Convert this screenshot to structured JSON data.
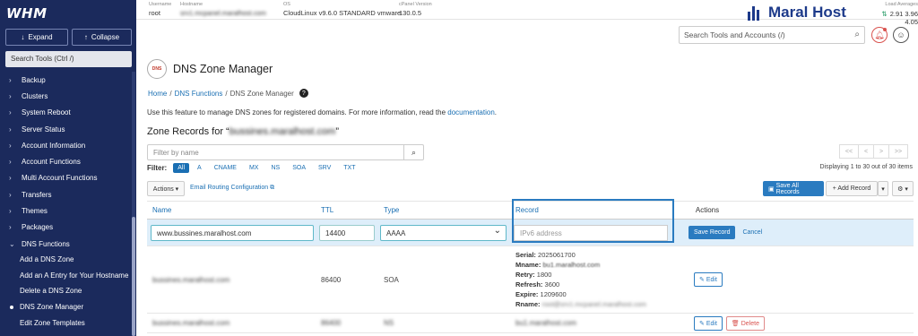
{
  "sidebar": {
    "logo": "WHM",
    "expand_label": "Expand",
    "collapse_label": "Collapse",
    "search_placeholder": "Search Tools (Ctrl /)",
    "items": [
      {
        "label": "Backup"
      },
      {
        "label": "Clusters"
      },
      {
        "label": "System Reboot"
      },
      {
        "label": "Server Status"
      },
      {
        "label": "Account Information"
      },
      {
        "label": "Account Functions"
      },
      {
        "label": "Multi Account Functions"
      },
      {
        "label": "Transfers"
      },
      {
        "label": "Themes"
      },
      {
        "label": "Packages"
      },
      {
        "label": "DNS Functions"
      }
    ],
    "sub_items": [
      {
        "label": "Add a DNS Zone"
      },
      {
        "label": "Add an A Entry for Your Hostname"
      },
      {
        "label": "Delete a DNS Zone"
      },
      {
        "label": "DNS Zone Manager"
      },
      {
        "label": "Edit Zone Templates"
      }
    ]
  },
  "topbar": {
    "username_label": "Username",
    "username": "root",
    "hostname_label": "Hostname",
    "hostname": "srv1.mcpanel.maralhost.com",
    "os_label": "OS",
    "os": "CloudLinux v9.6.0 STANDARD vmware",
    "cpanel_label": "cPanel Version",
    "cpanel": "130.0.5",
    "brand": "Maral Host",
    "load_label": "Load Averages",
    "load_values": "2.91  3.96  4.05",
    "search_placeholder": "Search Tools and Accounts (/)"
  },
  "page": {
    "icon_text": "DNS",
    "title": "DNS Zone Manager",
    "breadcrumb": [
      "Home",
      "DNS Functions",
      "DNS Zone Manager"
    ],
    "description": "Use this feature to manage DNS zones for registered domains. For more information, read the",
    "doc_link": "documentation",
    "zone_title_prefix": "Zone Records for “",
    "zone_domain": "bussines.maralhost.com",
    "zone_title_suffix": "”"
  },
  "filter": {
    "placeholder": "Filter by name",
    "label": "Filter:",
    "types": [
      "All",
      "A",
      "CNAME",
      "MX",
      "NS",
      "SOA",
      "SRV",
      "TXT"
    ],
    "displaying": "Displaying 1 to 30 out of 30 items",
    "pager": [
      "<<",
      "<",
      ">",
      ">>"
    ]
  },
  "toolbar": {
    "actions": "Actions ▾",
    "email_routing": "Email Routing Configuration",
    "save_all": "Save All Records",
    "add_record": "+ Add Record",
    "caret": "▾",
    "gear": "⚙ ▾"
  },
  "table": {
    "headers": {
      "name": "Name",
      "ttl": "TTL",
      "type": "Type",
      "record": "Record",
      "actions": "Actions"
    },
    "edit_row": {
      "name": "www.bussines.maralhost.com",
      "ttl": "14400",
      "type": "AAAA",
      "record_placeholder": "IPv6 address",
      "save": "Save Record",
      "cancel": "Cancel"
    },
    "soa_row": {
      "name": "bussines.maralhost.com",
      "ttl": "86400",
      "type": "SOA",
      "serial_label": "Serial:",
      "serial": "2025061700",
      "mname_label": "Mname:",
      "mname": "bu1.maralhost.com",
      "retry_label": "Retry:",
      "retry": "1800",
      "refresh_label": "Refresh:",
      "refresh": "3600",
      "expire_label": "Expire:",
      "expire": "1209600",
      "rname_label": "Rname:",
      "rname": "root@srv1.mcpanel.maralhost.com",
      "edit": "Edit"
    },
    "ns_row": {
      "name": "bussines.maralhost.com",
      "ttl": "86400",
      "type": "NS",
      "record": "bu1.maralhost.com",
      "edit": "Edit",
      "delete": "Delete"
    }
  }
}
